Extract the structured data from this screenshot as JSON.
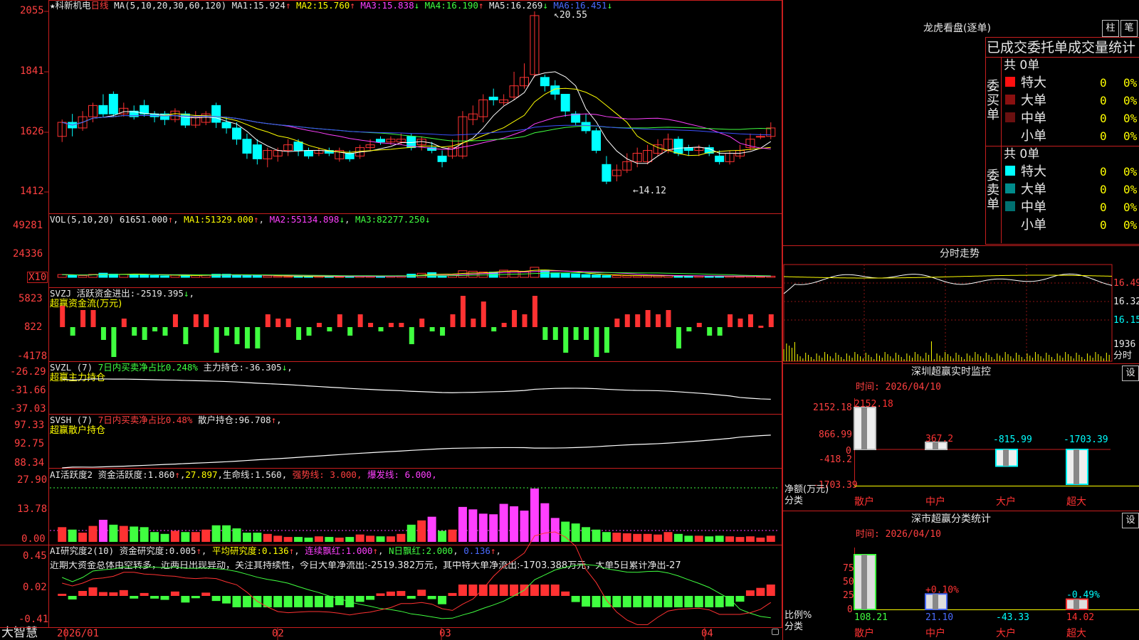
{
  "colors": {
    "up": "#ff3232",
    "down": "#00ffff",
    "frame": "#c81e1e",
    "grid": "#8c1414",
    "ma_white": "#ffffff",
    "ma_yellow": "#ffff00",
    "ma_magenta": "#ff40ff",
    "ma_green": "#40ff40",
    "ma_blue": "#3c50ff",
    "bg": "#000000"
  },
  "main": {
    "title_star": "★",
    "stock_name": "科新机电",
    "period": "日线",
    "ma_params": "MA(5,10,20,30,60,120)",
    "ma1_label": "MA1:",
    "ma1": "15.924",
    "ma1_arrow": "↑",
    "ma2_label": "MA2:",
    "ma2": "15.760",
    "ma2_arrow": "↑",
    "ma3_label": "MA3:",
    "ma3": "15.838",
    "ma3_arrow": "↓",
    "ma4_label": "MA4:",
    "ma4": "16.190",
    "ma4_arrow": "↑",
    "ma5_label": "MA5:",
    "ma5": "16.269",
    "ma5_arrow": "↓",
    "ma6_label": "MA6:",
    "ma6": "16.451",
    "ma6_arrow": "↓",
    "high_marker": "20.55",
    "low_marker": "←14.12",
    "y_ticks": [
      "2055",
      "1841",
      "1626",
      "1412"
    ]
  },
  "vol": {
    "header": "VOL(5,10,20)",
    "value": "61651.000",
    "value_arrow": "↑",
    "ma1_label": "MA1:",
    "ma1": "51329.000",
    "ma1_arrow": "↑",
    "ma2_label": "MA2:",
    "ma2": "55134.898",
    "ma2_arrow": "↓",
    "ma3_label": "MA3:",
    "ma3": "82277.250",
    "ma3_arrow": "↓",
    "y_ticks": [
      "49281",
      "24336"
    ],
    "unit": "X10"
  },
  "svzj": {
    "line1_name": "SVZJ",
    "line1_text": "活跃资金进出:",
    "line1_value": "-2519.395",
    "line1_arrow": "↓",
    "line1_tail": ",",
    "line2": "超赢资金流(万元)",
    "y_ticks": [
      "5823",
      "822",
      "-4178"
    ]
  },
  "svzl": {
    "name": "SVZL (7)",
    "label": "7日内买卖净占比",
    "value": "0.248%",
    "hold_label": "主力持仓:",
    "hold": "-36.305",
    "hold_arrow": "↓",
    "tail": ",",
    "line2": "超赢主力持仓",
    "y_ticks": [
      "-26.29",
      "-31.66",
      "-37.03"
    ]
  },
  "svsh": {
    "name": "SVSH (7)",
    "label": "7日内买卖净占比",
    "value": "0.48%",
    "hold_label": "散户持仓:",
    "hold": "96.708",
    "hold_arrow": "↑",
    "tail": ",",
    "line2": "超赢散户持仓",
    "y_ticks": [
      "97.33",
      "92.75",
      "88.34"
    ]
  },
  "ai1": {
    "name": "AI活跃度2",
    "act_label": "资金活跃度:",
    "act": "1.860",
    "act_arrow": "↑",
    "v2": "27.897",
    "v2_tail": ",",
    "life_label": "生命线:",
    "life": "1.560",
    "life_tail": ",",
    "strong": "强势线: 3.000,",
    "burst": "爆发线: 6.000,",
    "y_ticks": [
      "27.90",
      "13.78",
      "0.00"
    ]
  },
  "ai2": {
    "name": "AI研究度2(10)",
    "res_label": "资金研究度:",
    "res": "0.005",
    "res_arrow": "↑",
    "avg_label": "平均研究度:",
    "avg": "0.136",
    "avg_arrow": "↑",
    "cont_label": "连续飘红:",
    "cont": "1.000",
    "cont_arrow": "↑",
    "nday_label": "N日飘红:",
    "nday": "2.000",
    "v5": "0.136",
    "v5_arrow": "↑",
    "note": "近期大资金总体由空转多，近两日出现异动，关注其持续性，今日大单净流出:-2519.382万元，其中特大单净流出:-1703.388万元，大单5日累计净出-27",
    "y_ticks": [
      "0.45",
      "0.02",
      "-0.41"
    ]
  },
  "xaxis": {
    "labels": [
      "2026/01",
      "02",
      "03",
      "04"
    ]
  },
  "brand": "大智慧",
  "right": {
    "longhu_title": "龙虎看盘(逐单)",
    "btn_zhu": "柱",
    "btn_bi": "笔",
    "stats_title": "已成交委托单成交量统计",
    "buy_label": "委买单",
    "sell_label": "委卖单",
    "buy_total": "共 0单",
    "sell_total": "共 0单",
    "buy_rows": [
      {
        "name": "特大",
        "count": "0",
        "pct": "0%",
        "color": "#ff1010"
      },
      {
        "name": "大单",
        "count": "0",
        "pct": "0%",
        "color": "#8a1010"
      },
      {
        "name": "中单",
        "count": "0",
        "pct": "0%",
        "color": "#6a1010"
      },
      {
        "name": "小单",
        "count": "0",
        "pct": "0%",
        "color": "#000000"
      }
    ],
    "sell_rows": [
      {
        "name": "特大",
        "count": "0",
        "pct": "0%",
        "color": "#00ffff"
      },
      {
        "name": "大单",
        "count": "0",
        "pct": "0%",
        "color": "#008c8c"
      },
      {
        "name": "中单",
        "count": "0",
        "pct": "0%",
        "color": "#007070"
      },
      {
        "name": "小单",
        "count": "0",
        "pct": "0%",
        "color": "#000000"
      }
    ],
    "fenshi_title": "分时走势",
    "fenshi_y": [
      "16.49",
      "16.32",
      "16.15"
    ],
    "fenshi_vol": "1936",
    "fenshi_unit": "分时",
    "sz_title": "深圳超赢实时监控",
    "sz_settings": "设",
    "sz_time": "时间: 2026/04/10",
    "sz_y": [
      "2152.18",
      "866.99",
      "0",
      "-418.2",
      "-1703.39"
    ],
    "sz_ylabel": "净额(万元)",
    "sz_xlabel": "分类",
    "sz_bars": [
      {
        "name": "散户",
        "value": 2152.18,
        "label": "2152.18"
      },
      {
        "name": "中户",
        "value": 367.2,
        "label": "367.2"
      },
      {
        "name": "大户",
        "value": -815.99,
        "label": "-815.99"
      },
      {
        "name": "超大",
        "value": -1703.39,
        "label": "-1703.39"
      }
    ],
    "cls_title": "深市超赢分类统计",
    "cls_settings": "设",
    "cls_time": "时间: 2026/04/10",
    "cls_y": [
      "75",
      "50",
      "25",
      "0"
    ],
    "cls_ylabel": "比例%",
    "cls_xlabel": "分类",
    "cls_bars": [
      {
        "name": "散户",
        "value": 108.21,
        "label": "108.21",
        "top": ""
      },
      {
        "name": "中户",
        "value": 21.1,
        "label": "21.10",
        "top": "+0.10%"
      },
      {
        "name": "大户",
        "value": -43.33,
        "label": "-43.33",
        "top": ""
      },
      {
        "name": "超大",
        "value": 14.02,
        "label": "14.02",
        "top": "-0.49%"
      }
    ]
  },
  "chart_data": [
    {
      "type": "candlestick",
      "title": "科新机电 日线",
      "ylabel": "",
      "ylim": [
        1412,
        2055
      ],
      "high": 20.55,
      "low": 14.12,
      "series": [
        {
          "name": "MA1",
          "last": 15.924
        },
        {
          "name": "MA2",
          "last": 15.76
        },
        {
          "name": "MA3",
          "last": 15.838
        },
        {
          "name": "MA4",
          "last": 16.19
        },
        {
          "name": "MA5",
          "last": 16.269
        },
        {
          "name": "MA6",
          "last": 16.451
        }
      ],
      "candles": [
        [
          1610,
          1660,
          1590,
          1670
        ],
        [
          1660,
          1640,
          1610,
          1690
        ],
        [
          1640,
          1680,
          1630,
          1700
        ],
        [
          1680,
          1720,
          1660,
          1730
        ],
        [
          1720,
          1690,
          1680,
          1760
        ],
        [
          1760,
          1690,
          1680,
          1770
        ],
        [
          1690,
          1710,
          1680,
          1730
        ],
        [
          1700,
          1680,
          1670,
          1720
        ],
        [
          1720,
          1690,
          1680,
          1740
        ],
        [
          1690,
          1680,
          1660,
          1700
        ],
        [
          1690,
          1670,
          1650,
          1700
        ],
        [
          1670,
          1700,
          1660,
          1710
        ],
        [
          1690,
          1650,
          1640,
          1700
        ],
        [
          1650,
          1680,
          1640,
          1700
        ],
        [
          1660,
          1690,
          1650,
          1700
        ],
        [
          1720,
          1660,
          1640,
          1730
        ],
        [
          1660,
          1640,
          1620,
          1680
        ],
        [
          1640,
          1600,
          1580,
          1660
        ],
        [
          1600,
          1550,
          1530,
          1620
        ],
        [
          1580,
          1530,
          1510,
          1600
        ],
        [
          1530,
          1560,
          1500,
          1570
        ],
        [
          1540,
          1560,
          1520,
          1570
        ],
        [
          1560,
          1580,
          1540,
          1600
        ],
        [
          1590,
          1560,
          1540,
          1600
        ],
        [
          1560,
          1540,
          1530,
          1570
        ],
        [
          1550,
          1560,
          1540,
          1570
        ],
        [
          1560,
          1550,
          1540,
          1570
        ],
        [
          1530,
          1560,
          1520,
          1570
        ],
        [
          1550,
          1530,
          1520,
          1560
        ],
        [
          1540,
          1570,
          1530,
          1580
        ],
        [
          1570,
          1580,
          1560,
          1600
        ],
        [
          1600,
          1590,
          1580,
          1610
        ],
        [
          1590,
          1600,
          1580,
          1610
        ],
        [
          1590,
          1600,
          1580,
          1620
        ],
        [
          1610,
          1570,
          1560,
          1620
        ],
        [
          1580,
          1600,
          1560,
          1610
        ],
        [
          1570,
          1560,
          1550,
          1590
        ],
        [
          1540,
          1520,
          1500,
          1560
        ],
        [
          1540,
          1570,
          1530,
          1600
        ],
        [
          1540,
          1680,
          1530,
          1700
        ],
        [
          1670,
          1690,
          1650,
          1720
        ],
        [
          1680,
          1740,
          1660,
          1760
        ],
        [
          1750,
          1740,
          1720,
          1780
        ],
        [
          1730,
          1740,
          1720,
          1760
        ],
        [
          1750,
          1790,
          1740,
          1840
        ],
        [
          1790,
          1820,
          1780,
          1870
        ],
        [
          1830,
          2040,
          1820,
          2055
        ],
        [
          1820,
          1790,
          1770,
          1830
        ],
        [
          1790,
          1760,
          1740,
          1810
        ],
        [
          1760,
          1700,
          1680,
          1760
        ],
        [
          1690,
          1660,
          1650,
          1700
        ],
        [
          1660,
          1630,
          1620,
          1690
        ],
        [
          1630,
          1560,
          1550,
          1640
        ],
        [
          1510,
          1450,
          1440,
          1540
        ],
        [
          1470,
          1490,
          1450,
          1510
        ],
        [
          1490,
          1520,
          1480,
          1550
        ],
        [
          1520,
          1550,
          1500,
          1570
        ],
        [
          1520,
          1560,
          1510,
          1580
        ],
        [
          1550,
          1580,
          1540,
          1600
        ],
        [
          1560,
          1600,
          1550,
          1620
        ],
        [
          1600,
          1550,
          1540,
          1610
        ],
        [
          1570,
          1560,
          1540,
          1580
        ],
        [
          1560,
          1570,
          1540,
          1580
        ],
        [
          1570,
          1550,
          1540,
          1580
        ],
        [
          1540,
          1520,
          1510,
          1560
        ],
        [
          1520,
          1550,
          1510,
          1560
        ],
        [
          1540,
          1560,
          1530,
          1580
        ],
        [
          1570,
          1600,
          1560,
          1620
        ],
        [
          1610,
          1610,
          1600,
          1620
        ],
        [
          1610,
          1640,
          1600,
          1660
        ]
      ]
    },
    {
      "type": "bar",
      "title": "VOL(5,10,20)",
      "ylim": [
        0,
        49281
      ],
      "values": [
        2400,
        2000,
        1500,
        2600,
        3600,
        2800,
        2600,
        2500,
        2400,
        1600,
        1300,
        1800,
        1600,
        1600,
        2000,
        2700,
        2700,
        2200,
        1500,
        1500,
        1300,
        1000,
        800,
        800,
        700,
        900,
        800,
        600,
        800,
        1200,
        1000,
        900,
        900,
        1300,
        2800,
        3500,
        4100,
        1800,
        2000,
        5700,
        5300,
        4600,
        4500,
        6200,
        5800,
        5100,
        8700,
        6300,
        3900,
        3300,
        3000,
        2400,
        2000,
        1600,
        1500,
        1400,
        1300,
        1300,
        1200,
        1600,
        1300,
        1000,
        1000,
        900,
        1000,
        900,
        800,
        900,
        700,
        1000
      ]
    }
  ]
}
